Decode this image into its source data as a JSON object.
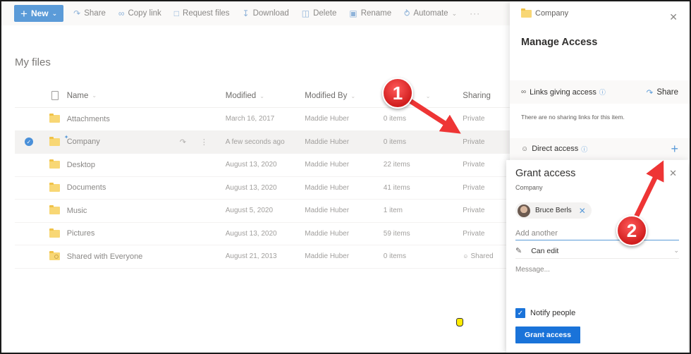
{
  "command_bar": {
    "new_label": "New",
    "items": [
      {
        "label": "Share",
        "icon": "share-icon"
      },
      {
        "label": "Copy link",
        "icon": "link-icon"
      },
      {
        "label": "Request files",
        "icon": "request-files-icon"
      },
      {
        "label": "Download",
        "icon": "download-icon"
      },
      {
        "label": "Delete",
        "icon": "delete-icon"
      },
      {
        "label": "Rename",
        "icon": "rename-icon"
      },
      {
        "label": "Automate",
        "icon": "automate-icon"
      }
    ],
    "more_label": "···"
  },
  "page_title": "My files",
  "table": {
    "columns": {
      "name": "Name",
      "modified": "Modified",
      "modified_by": "Modified By",
      "size": "",
      "sharing": "Sharing"
    },
    "rows": [
      {
        "name": "Attachments",
        "modified": "March 16, 2017",
        "modified_by": "Maddie Huber",
        "size": "0 items",
        "sharing": "Private"
      },
      {
        "name": "Company",
        "modified": "A few seconds ago",
        "modified_by": "Maddie Huber",
        "size": "0 items",
        "sharing": "Private",
        "selected": true
      },
      {
        "name": "Desktop",
        "modified": "August 13, 2020",
        "modified_by": "Maddie Huber",
        "size": "22 items",
        "sharing": "Private"
      },
      {
        "name": "Documents",
        "modified": "August 13, 2020",
        "modified_by": "Maddie Huber",
        "size": "41 items",
        "sharing": "Private"
      },
      {
        "name": "Music",
        "modified": "August 5, 2020",
        "modified_by": "Maddie Huber",
        "size": "1 item",
        "sharing": "Private"
      },
      {
        "name": "Pictures",
        "modified": "August 13, 2020",
        "modified_by": "Maddie Huber",
        "size": "59 items",
        "sharing": "Private"
      },
      {
        "name": "Shared with Everyone",
        "modified": "August 21, 2013",
        "modified_by": "Maddie Huber",
        "size": "0 items",
        "sharing": "Shared"
      }
    ]
  },
  "manage_access": {
    "folder_name": "Company",
    "title": "Manage Access",
    "links_section": "Links giving access",
    "share_label": "Share",
    "no_links_text": "There are no sharing links for this item.",
    "direct_section": "Direct access"
  },
  "grant_access": {
    "title": "Grant access",
    "subtitle": "Company",
    "person": "Bruce Berls",
    "add_placeholder": "Add another",
    "permission": "Can edit",
    "message_placeholder": "Message...",
    "notify_label": "Notify people",
    "notify_checked": true,
    "button_label": "Grant access"
  },
  "callouts": [
    {
      "number": "1"
    },
    {
      "number": "2"
    }
  ],
  "colors": {
    "accent": "#1a73d9",
    "new_button": "#5b9bd8",
    "callout": "#e02424"
  }
}
